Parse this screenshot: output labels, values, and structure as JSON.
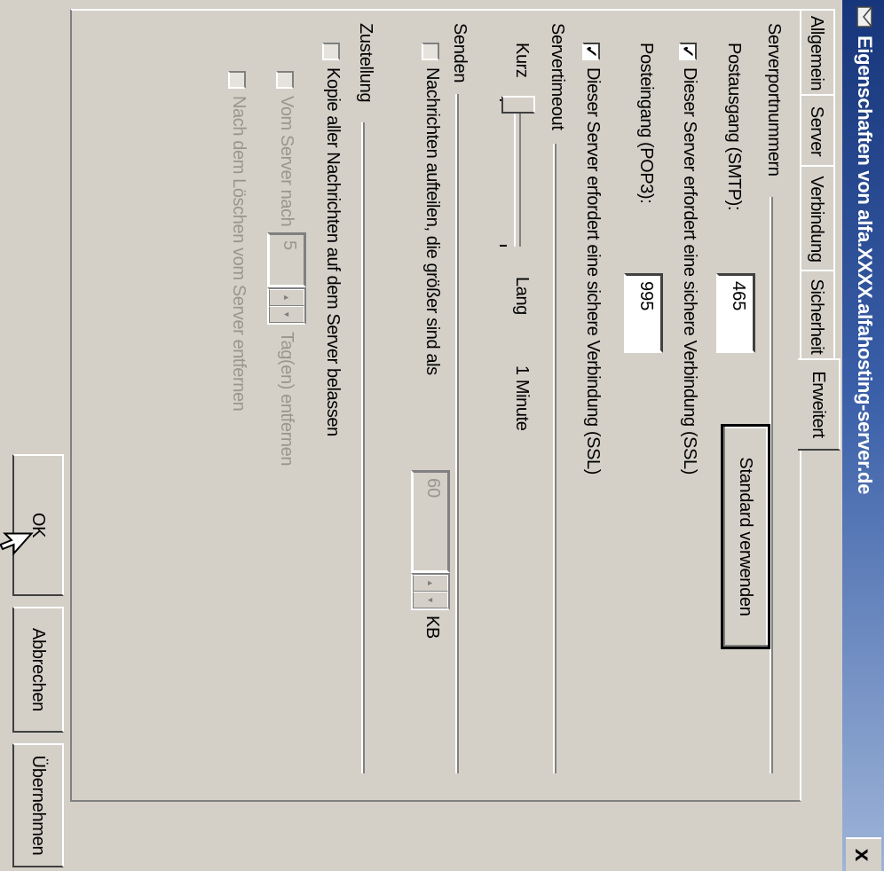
{
  "window": {
    "title": "Eigenschaften von alfa.XXXX.alfahosting-server.de",
    "close": "x"
  },
  "tabs": [
    {
      "label": "Allgemein"
    },
    {
      "label": "Server"
    },
    {
      "label": "Verbindung"
    },
    {
      "label": "Sicherheit"
    },
    {
      "label": "Erweitert",
      "active": true
    }
  ],
  "serverports": {
    "section": "Serverportnummern",
    "smtp_label": "Postausgang (SMTP):",
    "smtp_value": "465",
    "default_button": "Standard verwenden",
    "smtp_ssl_label": "Dieser Server erfordert eine sichere Verbindung (SSL)",
    "smtp_ssl_checked": true,
    "pop3_label": "Posteingang (POP3):",
    "pop3_value": "995",
    "pop3_ssl_label": "Dieser Server erfordert eine sichere Verbindung (SSL)",
    "pop3_ssl_checked": true
  },
  "timeout": {
    "section": "Servertimeout",
    "short_label": "Kurz",
    "long_label": "Lang",
    "value_label": "1 Minute",
    "slider_fraction": 0.0
  },
  "send": {
    "section": "Senden",
    "split_label": "Nachrichten aufteilen, die größer sind als",
    "split_checked": false,
    "split_value": "60",
    "split_unit": "KB"
  },
  "delivery": {
    "section": "Zustellung",
    "keep_label": "Kopie aller Nachrichten auf dem Server belassen",
    "keep_checked": false,
    "remove_after_label": "Vom Server nach",
    "remove_after_value": "5",
    "remove_after_unit": "Tag(en) entfernen",
    "remove_on_delete_label": "Nach dem Löschen vom Server entfernen"
  },
  "buttons": {
    "ok": "OK",
    "cancel": "Abbrechen",
    "apply": "Übernehmen"
  },
  "icons": {
    "window": "envelope-icon",
    "cursor": "mouse-pointer-icon"
  },
  "colors": {
    "titlebar_start": "#17357a",
    "titlebar_end": "#9eb4d8",
    "face": "#d4d0c8",
    "disabled_text": "#9a968e"
  }
}
